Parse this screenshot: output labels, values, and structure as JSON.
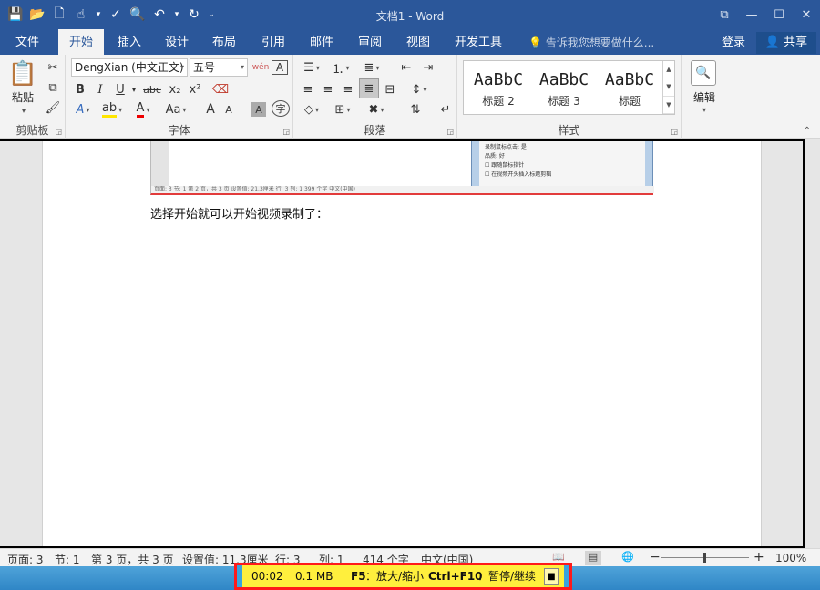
{
  "titlebar": {
    "doc_title": "文档1 - Word",
    "qat": [
      {
        "icon": "save-icon",
        "glyph": "💾"
      },
      {
        "icon": "open-folder-icon",
        "glyph": "📂"
      },
      {
        "icon": "new-document-icon",
        "glyph": "🗋"
      },
      {
        "icon": "touch-mode-icon",
        "glyph": "☝"
      },
      {
        "icon": "spelling-icon",
        "glyph": "✓"
      },
      {
        "icon": "print-preview-icon",
        "glyph": "🔍"
      },
      {
        "icon": "undo-icon",
        "glyph": "↶"
      },
      {
        "icon": "redo-icon",
        "glyph": "↻"
      },
      {
        "icon": "customize-qat-icon",
        "glyph": "⌄"
      }
    ],
    "window_controls": [
      "⧉",
      "—",
      "☐",
      "✕"
    ]
  },
  "tabs": {
    "file": "文件",
    "home": "开始",
    "insert": "插入",
    "design": "设计",
    "layout": "布局",
    "references": "引用",
    "mailings": "邮件",
    "review": "审阅",
    "view": "视图",
    "developer": "开发工具",
    "tell_me": "告诉我您想要做什么...",
    "login": "登录",
    "share": "共享"
  },
  "ribbon": {
    "clipboard": {
      "label": "剪贴板",
      "paste": "粘贴"
    },
    "font": {
      "label": "字体",
      "font_name": "DengXian (中文正文)",
      "font_size": "五号",
      "phonetic": "wén",
      "bold": "B",
      "italic": "I",
      "underline": "U",
      "strike": "abc",
      "subscript": "x₂",
      "superscript": "x²",
      "change_case": "Aa",
      "grow": "A",
      "shrink": "A",
      "shade": "A",
      "enclose": "字"
    },
    "paragraph": {
      "label": "段落"
    },
    "styles": {
      "label": "样式",
      "items": [
        {
          "sample": "AaBbC",
          "name": "标题 2"
        },
        {
          "sample": "AaBbC",
          "name": "标题 3"
        },
        {
          "sample": "AaBbC",
          "name": "标题"
        }
      ]
    },
    "editing": {
      "label": "编辑"
    }
  },
  "document": {
    "body_text": "选择开始就可以开始视频录制了：",
    "embedded_status": "页面: 3   节: 1   第 2 页，共 3 页   设置值: 21.3厘米   行: 3   列: 1   399 个字   中文(中国)",
    "embedded_dialog_lines": [
      "录制鼠标点击:            是",
      "品质:                    好",
      "☐ 跟随鼠标指针",
      "☐ 在视频开头插入标题剪辑"
    ]
  },
  "statusbar": {
    "page": "页面: 3",
    "section": "节: 1",
    "page_of": "第 3 页，共 3 页",
    "position": "设置值: 11.3厘米",
    "line": "行: 3",
    "column": "列: 1",
    "words": "414 个字",
    "language": "中文(中国)",
    "zoom_minus": "−",
    "zoom_plus": "+",
    "zoom": "100%",
    "zoom_level": 1.0
  },
  "recorder": {
    "elapsed": "00:02",
    "size": "0.1 MB",
    "hotkey1_key": "F5",
    "hotkey1_action": "：放大/缩小",
    "hotkey2_key": "Ctrl+F10",
    "hotkey2_action": "：暂停/继续",
    "stop_glyph": "■"
  },
  "colors": {
    "title_blue": "#2b579a",
    "recorder_yellow": "#ffef3d",
    "recorder_border": "#ff1a1a"
  }
}
